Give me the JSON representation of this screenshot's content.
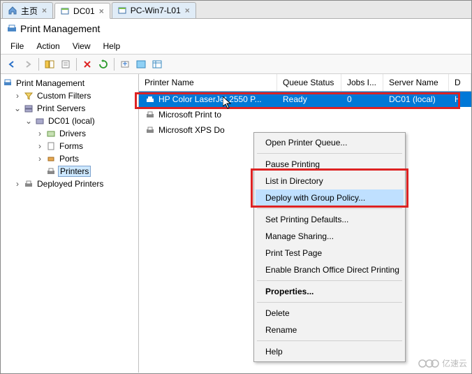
{
  "tabs": [
    {
      "label": "主页"
    },
    {
      "label": "DC01"
    },
    {
      "label": "PC-Win7-L01"
    }
  ],
  "window_title": "Print Management",
  "menubar": {
    "file": "File",
    "action": "Action",
    "view": "View",
    "help": "Help"
  },
  "tree": {
    "root": "Print Management",
    "custom_filters": "Custom Filters",
    "print_servers": "Print Servers",
    "dc01": "DC01 (local)",
    "drivers": "Drivers",
    "forms": "Forms",
    "ports": "Ports",
    "printers": "Printers",
    "deployed": "Deployed Printers"
  },
  "list": {
    "headers": {
      "name": "Printer Name",
      "queue": "Queue Status",
      "jobs": "Jobs I...",
      "server": "Server Name",
      "d": "D"
    },
    "rows": [
      {
        "name": "HP Color LaserJet 2550 P...",
        "queue": "Ready",
        "jobs": "0",
        "server": "DC01 (local)",
        "d": "H"
      },
      {
        "name": "Microsoft Print to"
      },
      {
        "name": "Microsoft XPS Do"
      }
    ]
  },
  "context_menu": {
    "open_queue": "Open Printer Queue...",
    "pause": "Pause Printing",
    "list_dir": "List in Directory",
    "deploy": "Deploy with Group Policy...",
    "defaults": "Set Printing Defaults...",
    "sharing": "Manage Sharing...",
    "test_page": "Print Test Page",
    "branch": "Enable Branch Office Direct Printing",
    "properties": "Properties...",
    "delete": "Delete",
    "rename": "Rename",
    "help": "Help"
  },
  "watermark": "亿速云"
}
